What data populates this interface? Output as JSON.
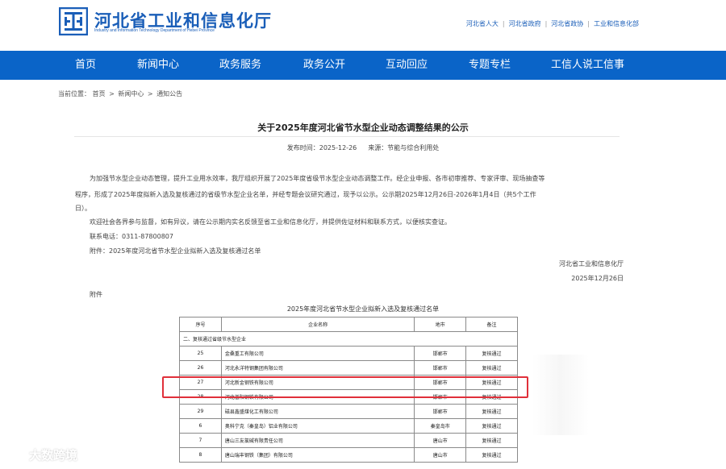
{
  "header": {
    "site_title": "河北省工业和信息化厅",
    "site_subtitle": "Industry and Information Technology Department of Hebei Province",
    "top_links": [
      "河北省人大",
      "河北省政府",
      "河北省政协",
      "工业和信息化部"
    ]
  },
  "nav": {
    "items": [
      "首页",
      "新闻中心",
      "政务服务",
      "政务公开",
      "互动回应",
      "专题专栏",
      "工信人说工信事"
    ]
  },
  "breadcrumb": {
    "prefix": "当前位置：",
    "items": [
      "首页",
      "新闻中心",
      "通知公告"
    ],
    "separator": ">"
  },
  "article": {
    "title": "关于2025年度河北省节水型企业动态调整结果的公示",
    "publish_label": "发布时间：",
    "publish_date": "2025-12-26",
    "source_label": "来源：",
    "source": "节能与综合利用处",
    "para1_line1": "为加强节水型企业动态管理，提升工业用水效率，我厅组织开展了2025年度省级节水型企业动态调整工作。经企业申报、各市初审推荐、专家评审、现场抽查等",
    "para1_line2": "程序，形成了2025年度拟新入选及复核通过的省级节水型企业名单，并经专题会议研究通过，现予以公示。公示期2025年12月26日-2026年1月4日（共5个工作",
    "para1_line3": "日）。",
    "para2": "欢迎社会各界参与监督，如有异议，请在公示期内实名反馈至省工业和信息化厅，并提供佐证材料和联系方式，以便核实查证。",
    "contact": "联系电话：0311-87800807",
    "attachment": "附件：2025年度河北省节水型企业拟新入选及复核通过名单",
    "signature_org": "河北省工业和信息化厅",
    "signature_date": "2025年12月26日",
    "appendix_label": "附件"
  },
  "table": {
    "caption": "2025年度河北省节水型企业拟新入选及复核通过名单",
    "headers": [
      "序号",
      "企业名称",
      "地市",
      "备注"
    ],
    "section": "二、复核通过省级节水型企业",
    "rows": [
      [
        "25",
        "金桑重工有限公司",
        "邯郸市",
        "复核通过"
      ],
      [
        "26",
        "河北永洋特钢集团有限公司",
        "邯郸市",
        "复核通过"
      ],
      [
        "27",
        "河北新金钢铁有限公司",
        "邯郸市",
        "复核通过"
      ],
      [
        "28",
        "河北普阳钢铁有限公司",
        "邯郸市",
        "复核通过"
      ],
      [
        "29",
        "磁县鑫盛煤化工有限公司",
        "邯郸市",
        "复核通过"
      ],
      [
        "6",
        "奥科宁克（秦皇岛）铝业有限公司",
        "秦皇岛市",
        "复核通过"
      ],
      [
        "7",
        "唐山三友氯碱有限责任公司",
        "唐山市",
        "复核通过"
      ],
      [
        "8",
        "唐山瑞丰钢铁（集团）有限公司",
        "唐山市",
        "复核通过"
      ]
    ]
  },
  "watermark": {
    "text": "大数跨境"
  },
  "colors": {
    "brand_blue": "#0a64c8",
    "highlight_red": "#e0303a"
  }
}
